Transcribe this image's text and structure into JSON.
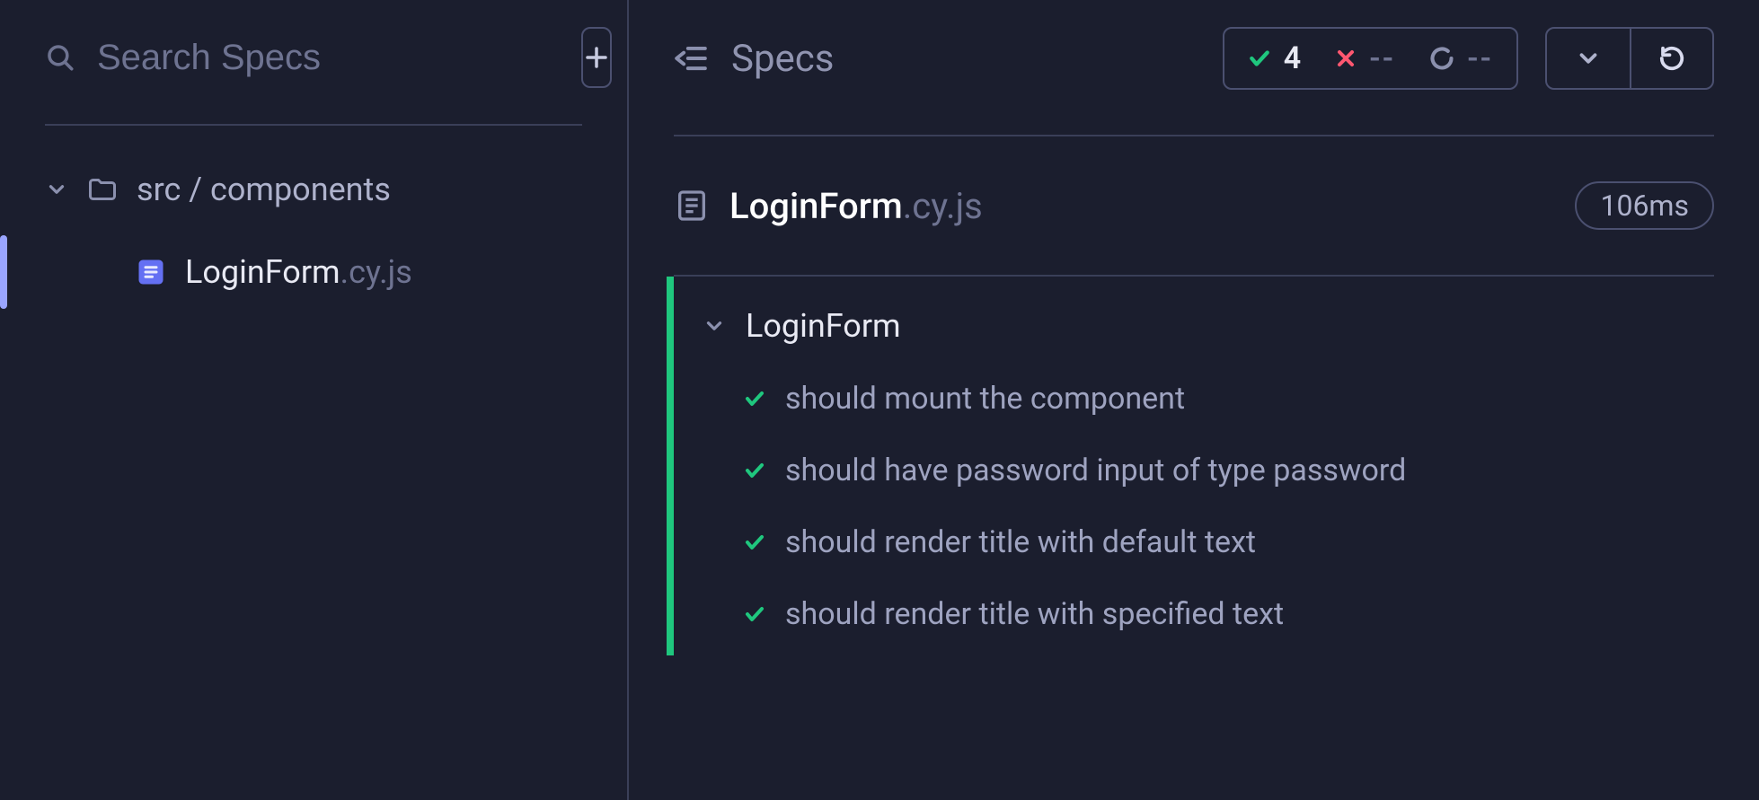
{
  "sidebar": {
    "search_placeholder": "Search Specs",
    "folder_path": "src / components",
    "spec": {
      "name": "LoginForm",
      "ext": ".cy.js"
    }
  },
  "header": {
    "title": "Specs",
    "stats": {
      "passed": "4",
      "failed": "--",
      "pending": "--"
    }
  },
  "runner": {
    "spec_name": "LoginForm",
    "spec_ext": ".cy.js",
    "duration": "106ms",
    "suite": "LoginForm",
    "tests": [
      "should mount the component",
      "should have password input of type password",
      "should render title with default text",
      "should render title with specified text"
    ]
  }
}
